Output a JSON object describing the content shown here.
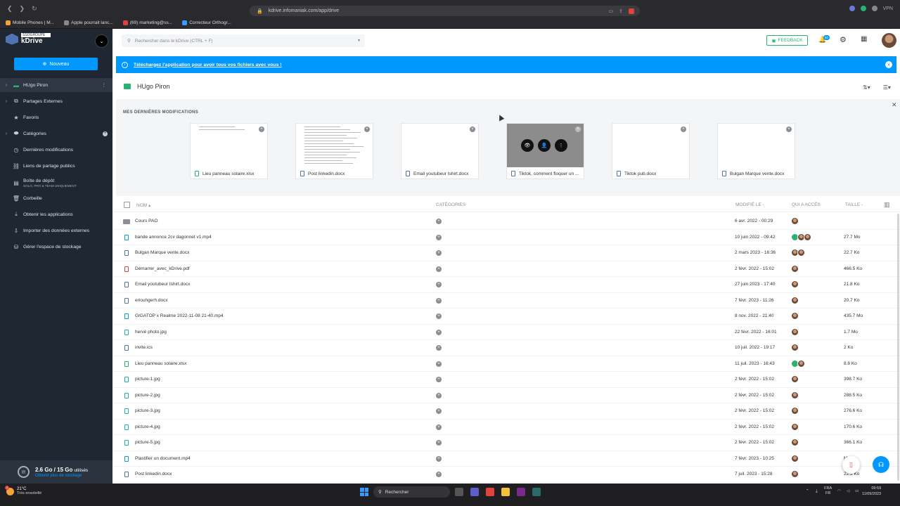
{
  "browser": {
    "url": "kdrive.infomaniak.com/app/drive",
    "vpn_label": "VPN",
    "bookmarks": [
      {
        "label": "Mobile Phones | M...",
        "color": "#f2a33a"
      },
      {
        "label": "Apple pourrait lanc...",
        "color": "#888888"
      },
      {
        "label": "(69) marketing@ss...",
        "color": "#e0433b"
      },
      {
        "label": "Correcteur Orthogr...",
        "color": "#3a9bff"
      }
    ]
  },
  "sidebar": {
    "brand_badge": "SSOGROUPE",
    "brand_name": "kDrive",
    "new_button": "Nouveau",
    "items": [
      {
        "label": "HUgo Piron",
        "icon": "drive-icon",
        "chev": true,
        "active": true,
        "kebab": true
      },
      {
        "label": "Partages Externes",
        "icon": "shared-icon",
        "chev": true
      },
      {
        "label": "Favoris",
        "icon": "star-icon"
      },
      {
        "label": "Catégories",
        "icon": "tag-icon",
        "chev": true,
        "plus": true
      },
      {
        "label": "Dernières modifications",
        "icon": "clock-icon"
      },
      {
        "label": "Liens de partage publics",
        "icon": "link-icon"
      },
      {
        "label": "Boîte de dépôt",
        "sub": "SOLO, PRO & TEAM UNIQUEMENT",
        "icon": "dropbox-icon"
      },
      {
        "label": "Corbeille",
        "icon": "trash-icon"
      },
      {
        "label": "Obtenir les applications",
        "icon": "download-icon"
      },
      {
        "label": "Importer des données externes",
        "icon": "import-icon"
      },
      {
        "label": "Gérer l'espace de stockage",
        "icon": "storage-icon"
      }
    ],
    "storage": {
      "amount": "2.6 Go / 15 Go",
      "used_label": "utilisés",
      "link": "Obtenir plus de stockage",
      "used_fraction": 0.17
    }
  },
  "header": {
    "search_placeholder": "Rechercher dans le kDrive (CTRL + F)",
    "feedback_label": "FEEDBACK",
    "notif_count": "50"
  },
  "banner": {
    "message": "Téléchargez l'application pour avoir tous vos fichiers avec vous !"
  },
  "folder": {
    "title": "HUgo Piron"
  },
  "recent": {
    "title": "MES DERNIÈRES MODIFICATIONS",
    "cards": [
      {
        "name": "Lieu panneau solaire.xlsx",
        "type": "xlsx"
      },
      {
        "name": "Post linkedin.docx",
        "type": "docx"
      },
      {
        "name": "Email youtubeur tshirt.docx",
        "type": "docx"
      },
      {
        "name": "Tiktok, comment floquer un ...",
        "type": "docx",
        "hover": true
      },
      {
        "name": "Tiktok pub.docx",
        "type": "docx"
      },
      {
        "name": "Bulgan Marque vente.docx",
        "type": "docx"
      }
    ]
  },
  "table": {
    "headers": {
      "name": "NOM",
      "categories": "CATÉGORIES",
      "modified": "MODIFIÉ LE",
      "access": "QUI A ACCÈS",
      "size": "TAILLE"
    },
    "rows": [
      {
        "name": "Cours PAO",
        "type": "folder",
        "date": "6 avr. 2022 - 00:29",
        "access": [
          "av"
        ],
        "size": ""
      },
      {
        "name": "bande annonce 2cv dagonnet v1.mp4",
        "type": "mp4",
        "date": "10 juin 2022 - 09:42",
        "access": [
          "lk",
          "av",
          "av"
        ],
        "size": "27.7 Mo"
      },
      {
        "name": "Bulgan Marque vente.docx",
        "type": "docx",
        "date": "2 mars 2023 - 16:36",
        "access": [
          "av",
          "av"
        ],
        "size": "22.7 Ko"
      },
      {
        "name": "Démarrer_avec_kDrive.pdf",
        "type": "pdf",
        "date": "2 févr. 2022 - 15:02",
        "access": [
          "av"
        ],
        "size": "466.5 Ko"
      },
      {
        "name": "Email youtubeur tshirt.docx",
        "type": "docx",
        "date": "27 juin 2023 - 17:40",
        "access": [
          "av"
        ],
        "size": "21.8 Ko"
      },
      {
        "name": "eriouhgerh.docx",
        "type": "docx",
        "date": "7 févr. 2023 - 11:26",
        "access": [
          "av"
        ],
        "size": "20.7 Ko"
      },
      {
        "name": "GIGATOP x Realme 2022-11-08 21-40.mp4",
        "type": "mp4",
        "date": "8 nov. 2022 - 21:40",
        "access": [
          "av"
        ],
        "size": "435.7 Mo"
      },
      {
        "name": "hervé photo.jpg",
        "type": "jpg",
        "date": "22 févr. 2022 - 16:01",
        "access": [
          "av"
        ],
        "size": "1.7 Mo"
      },
      {
        "name": "invite.ics",
        "type": "ics",
        "date": "10 juil. 2022 - 19:17",
        "access": [
          "av"
        ],
        "size": "2 Ko"
      },
      {
        "name": "Lieu panneau solaire.xlsx",
        "type": "xlsx",
        "date": "11 juil. 2023 - 16:43",
        "access": [
          "lk",
          "av"
        ],
        "size": "8.8 Ko"
      },
      {
        "name": "picture-1.jpg",
        "type": "jpg",
        "date": "2 févr. 2022 - 15:02",
        "access": [
          "av"
        ],
        "size": "398.7 Ko"
      },
      {
        "name": "picture-2.jpg",
        "type": "jpg",
        "date": "2 févr. 2022 - 15:02",
        "access": [
          "av"
        ],
        "size": "288.5 Ko"
      },
      {
        "name": "picture-3.jpg",
        "type": "jpg",
        "date": "2 févr. 2022 - 15:02",
        "access": [
          "av"
        ],
        "size": "276.6 Ko"
      },
      {
        "name": "picture-4.jpg",
        "type": "jpg",
        "date": "2 févr. 2022 - 15:02",
        "access": [
          "av"
        ],
        "size": "170.6 Ko"
      },
      {
        "name": "picture-5.jpg",
        "type": "jpg",
        "date": "2 févr. 2022 - 15:02",
        "access": [
          "av"
        ],
        "size": "366.1 Ko"
      },
      {
        "name": "Plastifier un document.mp4",
        "type": "mp4",
        "date": "7 févr. 2023 - 10:25",
        "access": [
          "av"
        ],
        "size": "Mo"
      },
      {
        "name": "Post linkedin.docx",
        "type": "docx",
        "date": "7 juil. 2023 - 15:28",
        "access": [
          "av"
        ],
        "size": "22.3 Ko"
      }
    ]
  },
  "taskbar": {
    "temp": "21°C",
    "weather": "Très ensoleillé",
    "weather_badge": "1",
    "search_label": "Rechercher",
    "lang_top": "FRA",
    "lang_bottom": "FR",
    "time": "09:59",
    "date": "11/09/2023"
  }
}
